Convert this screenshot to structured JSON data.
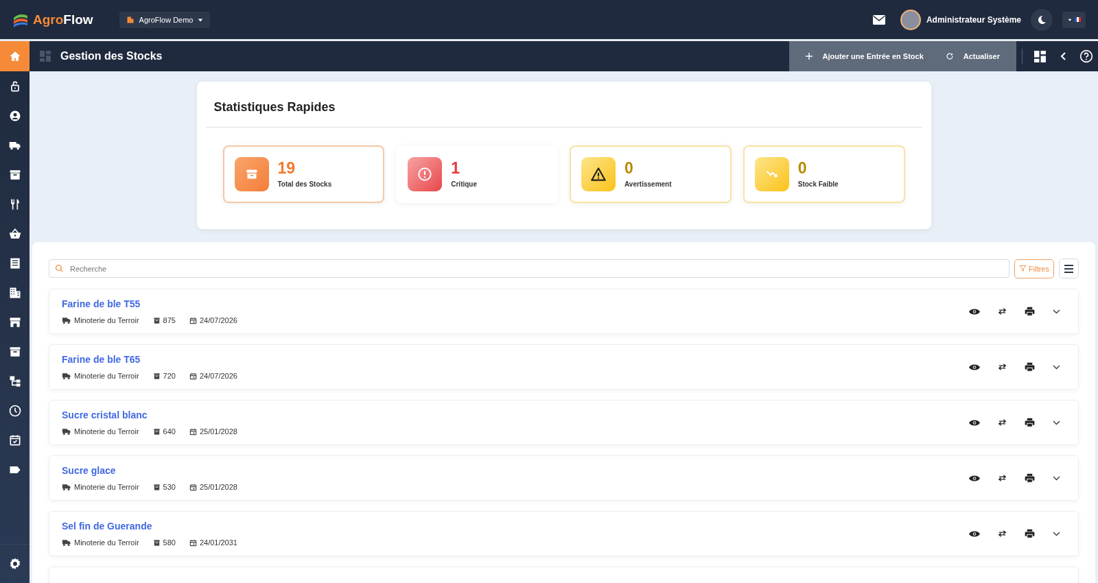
{
  "header": {
    "logo_part1": "Agro",
    "logo_part2": "Flow",
    "company": "AgroFlow Demo",
    "user": "Administrateur Système"
  },
  "toolbar": {
    "title": "Gestion des Stocks",
    "actions": [
      {
        "kind": "add",
        "label": "Ajouter une Entrée en Stock"
      },
      {
        "kind": "refresh",
        "label": "Actualiser"
      }
    ]
  },
  "sidebar": {
    "items": [
      {
        "kind": "home",
        "selected": true
      },
      {
        "kind": "lock",
        "selected": false
      },
      {
        "kind": "user",
        "selected": false
      },
      {
        "kind": "truck",
        "selected": false
      },
      {
        "kind": "archive",
        "selected": false
      },
      {
        "kind": "fork",
        "selected": false
      },
      {
        "kind": "basket",
        "selected": false
      },
      {
        "kind": "receipt",
        "selected": false
      },
      {
        "kind": "building",
        "selected": false
      },
      {
        "kind": "store",
        "selected": false
      },
      {
        "kind": "archive",
        "selected": false
      },
      {
        "kind": "tree",
        "selected": false
      },
      {
        "kind": "clock",
        "selected": false
      },
      {
        "kind": "calendar",
        "selected": false
      },
      {
        "kind": "tag",
        "selected": false
      }
    ]
  },
  "stats": {
    "title": "Statistiques Rapides",
    "cards": [
      {
        "kind": "total",
        "value": "19",
        "label": "Total des Stocks"
      },
      {
        "kind": "critical",
        "value": "1",
        "label": "Critique"
      },
      {
        "kind": "warning",
        "value": "0",
        "label": "Avertissement"
      },
      {
        "kind": "low",
        "value": "0",
        "label": "Stock Faible"
      }
    ]
  },
  "search": {
    "placeholder": "Recherche"
  },
  "filters_button": "Filtres",
  "stocks": [
    {
      "name": "Farine de ble T55",
      "supplier": "Minoterie du Terroir",
      "quantity": "875",
      "date": "24/07/2026"
    },
    {
      "name": "Farine de ble T65",
      "supplier": "Minoterie du Terroir",
      "quantity": "720",
      "date": "24/07/2026"
    },
    {
      "name": "Sucre cristal blanc",
      "supplier": "Minoterie du Terroir",
      "quantity": "640",
      "date": "25/01/2028"
    },
    {
      "name": "Sucre glace",
      "supplier": "Minoterie du Terroir",
      "quantity": "530",
      "date": "25/01/2028"
    },
    {
      "name": "Sel fin de Guerande",
      "supplier": "Minoterie du Terroir",
      "quantity": "580",
      "date": "24/01/2031"
    }
  ]
}
